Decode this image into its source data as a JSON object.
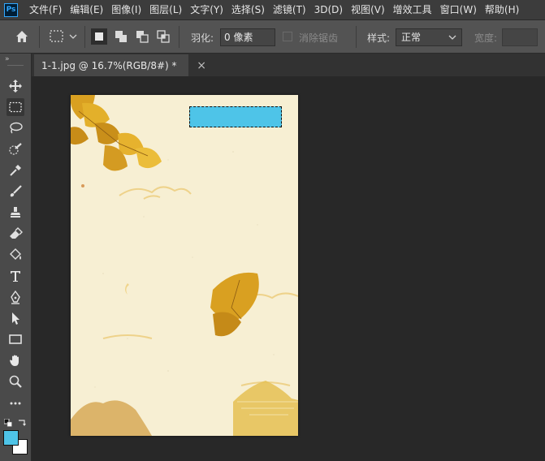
{
  "app": {
    "logo_text": "Ps"
  },
  "menu": [
    "文件(F)",
    "编辑(E)",
    "图像(I)",
    "图层(L)",
    "文字(Y)",
    "选择(S)",
    "滤镜(T)",
    "3D(D)",
    "视图(V)",
    "增效工具",
    "窗口(W)",
    "帮助(H)"
  ],
  "options": {
    "feather_label": "羽化:",
    "feather_value": "0 像素",
    "antialias_label": "消除锯齿",
    "style_label": "样式:",
    "style_value": "正常",
    "width_label": "宽度:"
  },
  "document": {
    "tab_title": "1-1.jpg @ 16.7%(RGB/8#) *",
    "close_glyph": "×"
  },
  "colors": {
    "foreground": "#4ec4e8",
    "background": "#ffffff",
    "selection_fill": "#4ec4e8"
  }
}
